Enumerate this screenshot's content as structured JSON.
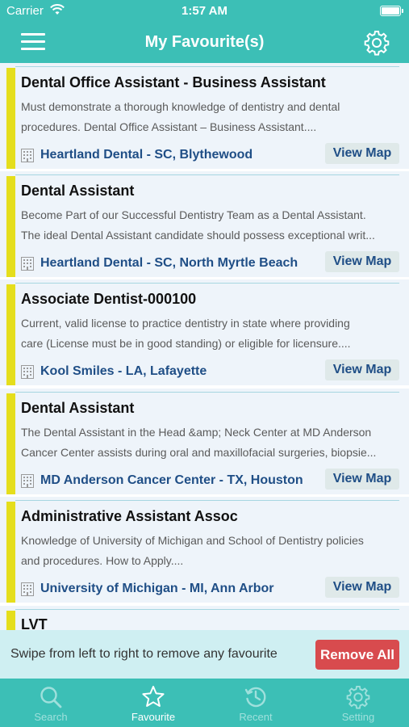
{
  "status": {
    "carrier": "Carrier",
    "time": "1:57 AM"
  },
  "header": {
    "title": "My Favourite(s)",
    "menu_icon": "hamburger-menu-icon",
    "settings_icon": "gear-icon"
  },
  "jobs": [
    {
      "title": "Dental Office Assistant - Business Assistant",
      "desc1": "Must demonstrate a thorough knowledge of dentistry and dental",
      "desc2": "procedures. Dental Office Assistant – Business Assistant....",
      "company": "Heartland Dental - SC, Blythewood",
      "action": "View Map"
    },
    {
      "title": "Dental Assistant",
      "desc1": "Become Part of our Successful Dentistry Team as a Dental Assistant.",
      "desc2": "The ideal Dental Assistant candidate should possess exceptional writ...",
      "company": "Heartland Dental - SC, North Myrtle Beach",
      "action": "View Map"
    },
    {
      "title": "Associate Dentist-000100",
      "desc1": "Current, valid license to practice dentistry in state where providing",
      "desc2": "care (License must be in good standing) or eligible for licensure....",
      "company": "Kool Smiles - LA, Lafayette",
      "action": "View Map"
    },
    {
      "title": "Dental Assistant",
      "desc1": "The Dental Assistant in the Head &amp; Neck Center at MD Anderson",
      "desc2": "Cancer Center assists during oral and maxillofacial surgeries, biopsie...",
      "company": "MD Anderson Cancer Center - TX, Houston",
      "action": "View Map"
    },
    {
      "title": "Administrative Assistant Assoc",
      "desc1": "Knowledge of University of Michigan and School of Dentistry policies",
      "desc2": "and procedures. How to Apply....",
      "company": "University of Michigan - MI, Ann Arbor",
      "action": "View Map"
    },
    {
      "title": "LVT",
      "desc1": "",
      "desc2": "",
      "company": "",
      "action": ""
    }
  ],
  "banner": {
    "hint": "Swipe from left to right to remove any favourite",
    "remove_label": "Remove All"
  },
  "tabs": [
    {
      "label": "Search",
      "icon": "search-icon",
      "active": false
    },
    {
      "label": "Favourite",
      "icon": "star-icon",
      "active": true
    },
    {
      "label": "Recent",
      "icon": "history-icon",
      "active": false
    },
    {
      "label": "Setting",
      "icon": "gear-icon",
      "active": false
    }
  ],
  "colors": {
    "primary": "#3cbfb6",
    "accent_bar": "#e5de1c",
    "link": "#1f4e86",
    "danger": "#d84b4e"
  }
}
